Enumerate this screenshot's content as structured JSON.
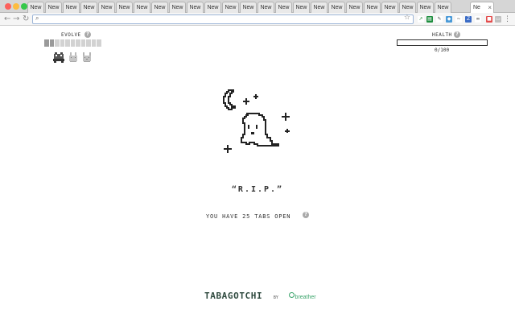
{
  "browser": {
    "tab_label": "New",
    "active_tab_label": "Ne",
    "tab_count_visible": 24,
    "address_value": ""
  },
  "evolve": {
    "label": "EVOLVE",
    "help": "?",
    "segments_total": 11,
    "segments_filled": 2,
    "stages": [
      "monster-stage-1-icon",
      "bunny-stage-2-icon",
      "bunny-stage-3-icon"
    ]
  },
  "health": {
    "label": "HEALTH",
    "help": "?",
    "value_text": "0/100",
    "value": 0,
    "max": 100
  },
  "main": {
    "rip_text": "“R.I.P.”",
    "tabs_open_text": "YOU HAVE 25 TABS OPEN",
    "help": "?"
  },
  "footer": {
    "brand": "TABAGOTCHI",
    "by": "BY",
    "partner": "breather"
  },
  "colors": {
    "ink": "#222222",
    "brand": "#2f4a3f",
    "partner": "#3aa36a",
    "evo_filled": "#9a9a9a",
    "evo_empty": "#d2d2d2"
  }
}
